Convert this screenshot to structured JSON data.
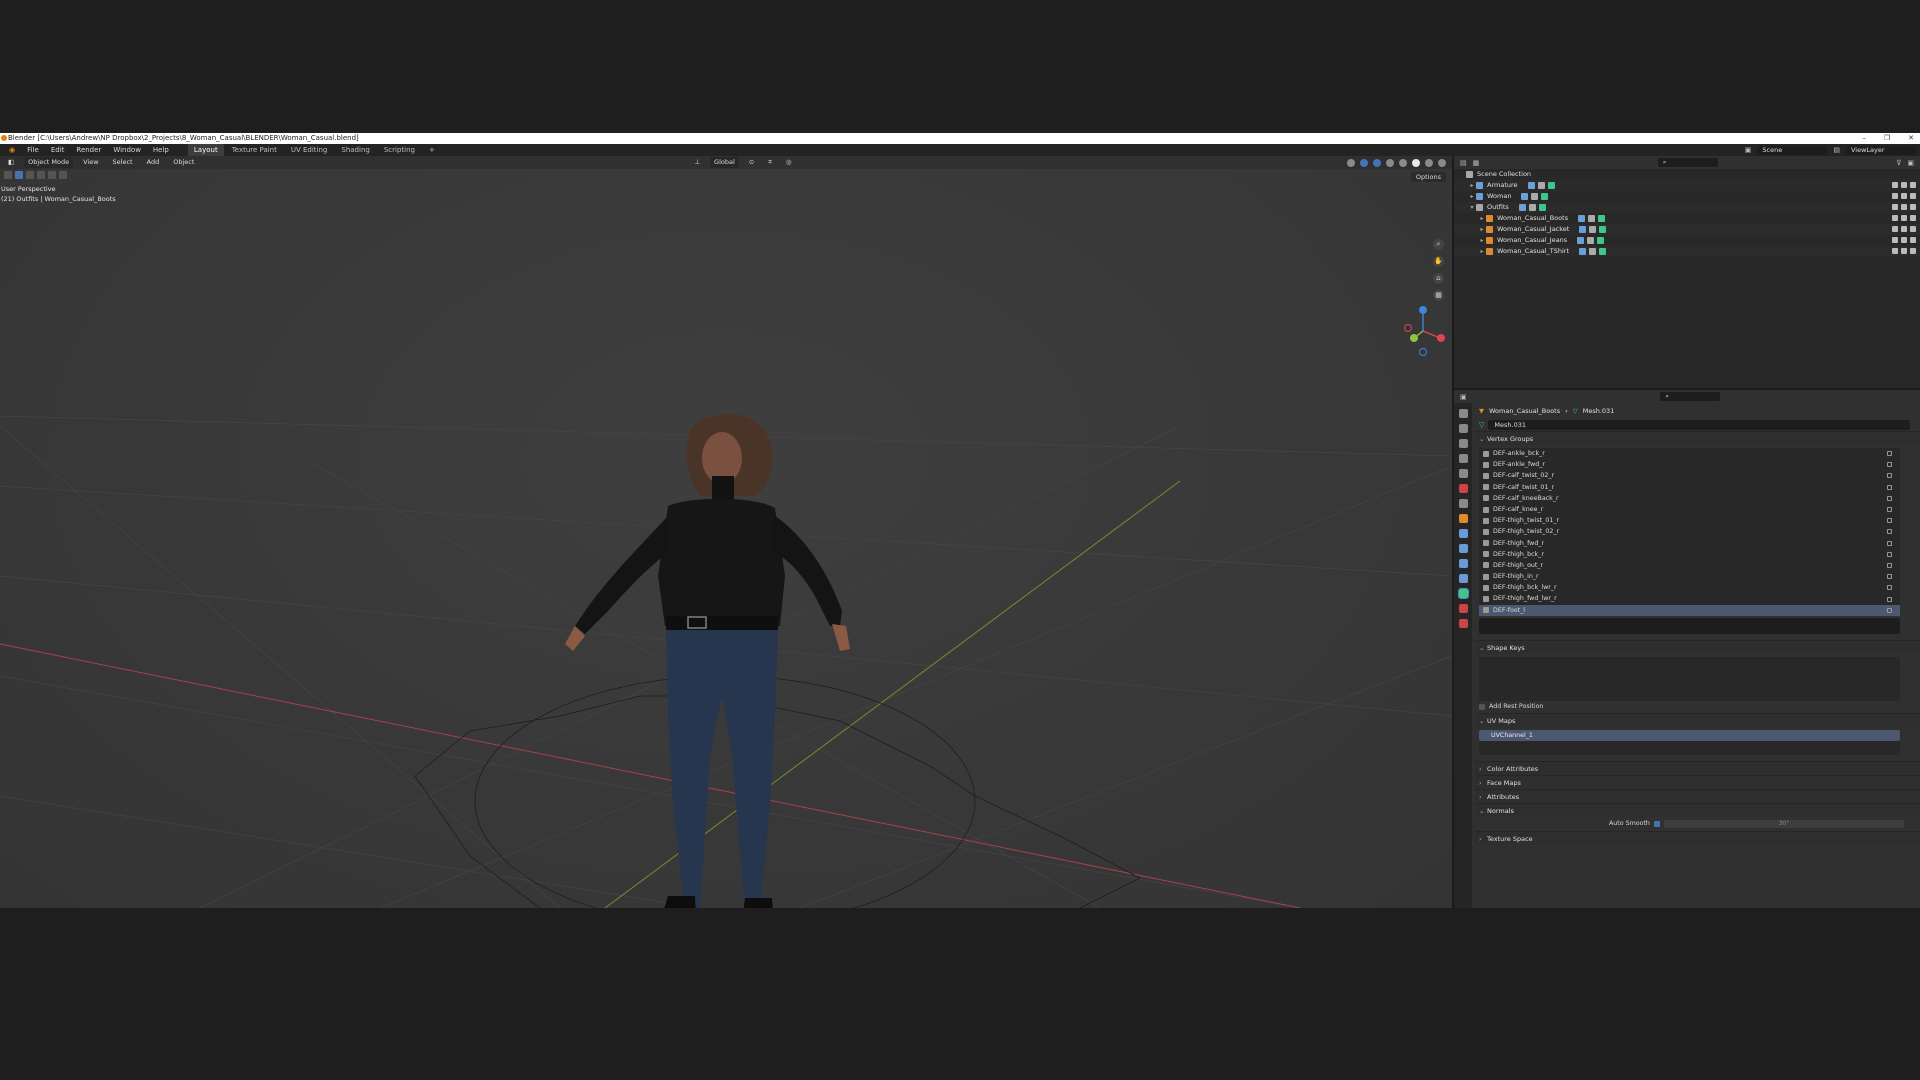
{
  "titlebar": {
    "title": "Blender [C:\\Users\\Andrew\\NP Dropbox\\2_Projects\\8_Woman_Casual\\BLENDER\\Woman_Casual.blend]",
    "min": "–",
    "max": "❐",
    "close": "✕"
  },
  "menubar": {
    "menus": [
      "File",
      "Edit",
      "Render",
      "Window",
      "Help"
    ],
    "workspaces": [
      "Layout",
      "Texture Paint",
      "UV Editing",
      "Shading",
      "Scripting",
      "+"
    ],
    "scene_label": "Scene",
    "viewlayer_label": "ViewLayer"
  },
  "viewport": {
    "mode": "Object Mode",
    "menus": [
      "View",
      "Select",
      "Add",
      "Object"
    ],
    "orientation": "Global",
    "options_label": "Options",
    "perspective_label": "User Perspective",
    "collection_label": "(21) Outfits | Woman_Casual_Boots",
    "gizmo_axes": {
      "x": "#e0464f",
      "y": "#8cc63f",
      "z": "#3e86d6"
    },
    "floor_lines": {
      "x_axis_color": "#a8414b",
      "y_axis_color": "#6f8f2f"
    }
  },
  "outliner": {
    "rows": [
      {
        "label": "Scene Collection",
        "indent": 0,
        "icon_color": "#a8a8a8"
      },
      {
        "label": "Armature",
        "indent": 1,
        "icon_color": "#6aa0d8"
      },
      {
        "label": "Woman",
        "indent": 1,
        "icon_color": "#6aa0d8"
      },
      {
        "label": "Outfits",
        "indent": 1,
        "icon_color": "#a8a8a8"
      },
      {
        "label": "Woman_Casual_Boots",
        "indent": 2,
        "icon_color": "#e08a2e"
      },
      {
        "label": "Woman_Casual_Jacket",
        "indent": 2,
        "icon_color": "#e08a2e"
      },
      {
        "label": "Woman_Casual_Jeans",
        "indent": 2,
        "icon_color": "#e08a2e"
      },
      {
        "label": "Woman_Casual_TShirt",
        "indent": 2,
        "icon_color": "#e08a2e"
      }
    ]
  },
  "properties": {
    "breadcrumb_object": "Woman_Casual_Boots",
    "breadcrumb_sep": "›",
    "breadcrumb_mesh": "Mesh.031",
    "mesh_name": "Mesh.031",
    "sections": {
      "vertex_groups": "Vertex Groups",
      "shape_keys": "Shape Keys",
      "add_rest_position": "Add Rest Position",
      "uv_maps": "UV Maps",
      "color_attributes": "Color Attributes",
      "face_maps": "Face Maps",
      "attributes": "Attributes",
      "normals": "Normals",
      "auto_smooth": "Auto Smooth",
      "auto_smooth_angle": "30°",
      "texture_space": "Texture Space"
    },
    "vertex_groups": [
      "DEF-ankle_bck_r",
      "DEF-ankle_fwd_r",
      "DEF-calf_twist_02_r",
      "DEF-calf_twist_01_r",
      "DEF-calf_kneeBack_r",
      "DEF-calf_knee_r",
      "DEF-thigh_twist_01_r",
      "DEF-thigh_twist_02_r",
      "DEF-thigh_fwd_r",
      "DEF-thigh_bck_r",
      "DEF-thigh_out_r",
      "DEF-thigh_in_r",
      "DEF-thigh_bck_lwr_r",
      "DEF-thigh_fwd_lwr_r",
      "DEF-foot_l"
    ],
    "selected_vertex_group": "DEF-foot_l",
    "uv_map": "UVChannel_1"
  }
}
